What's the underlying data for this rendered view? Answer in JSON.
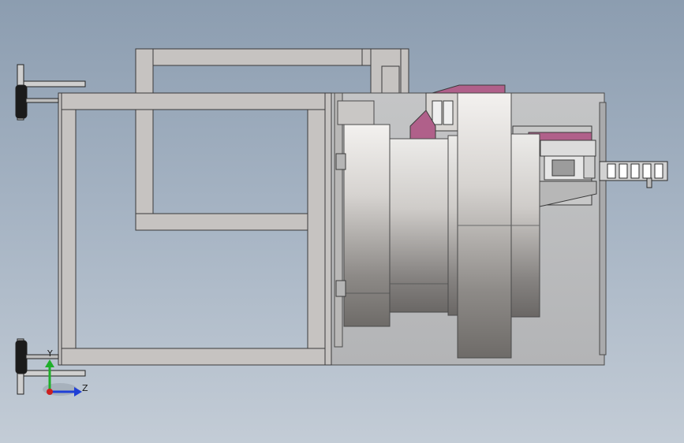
{
  "viewport": {
    "background": [
      "#8c9db0",
      "#c3ccd6"
    ],
    "model_colors": {
      "frame_fill": "#c6c3c1",
      "frame_edge": "#3a3a3a",
      "enclosure": "#bdbebf",
      "drum_light": "#f0eeec",
      "drum_dark": "#6e6b68",
      "bracket_accent": "#b0608a"
    }
  },
  "triad": {
    "y_label": "Y",
    "z_label": "Z",
    "y_color": "#1fae2b",
    "z_color": "#1f3fd6",
    "x_color": "#cc1f1f"
  }
}
